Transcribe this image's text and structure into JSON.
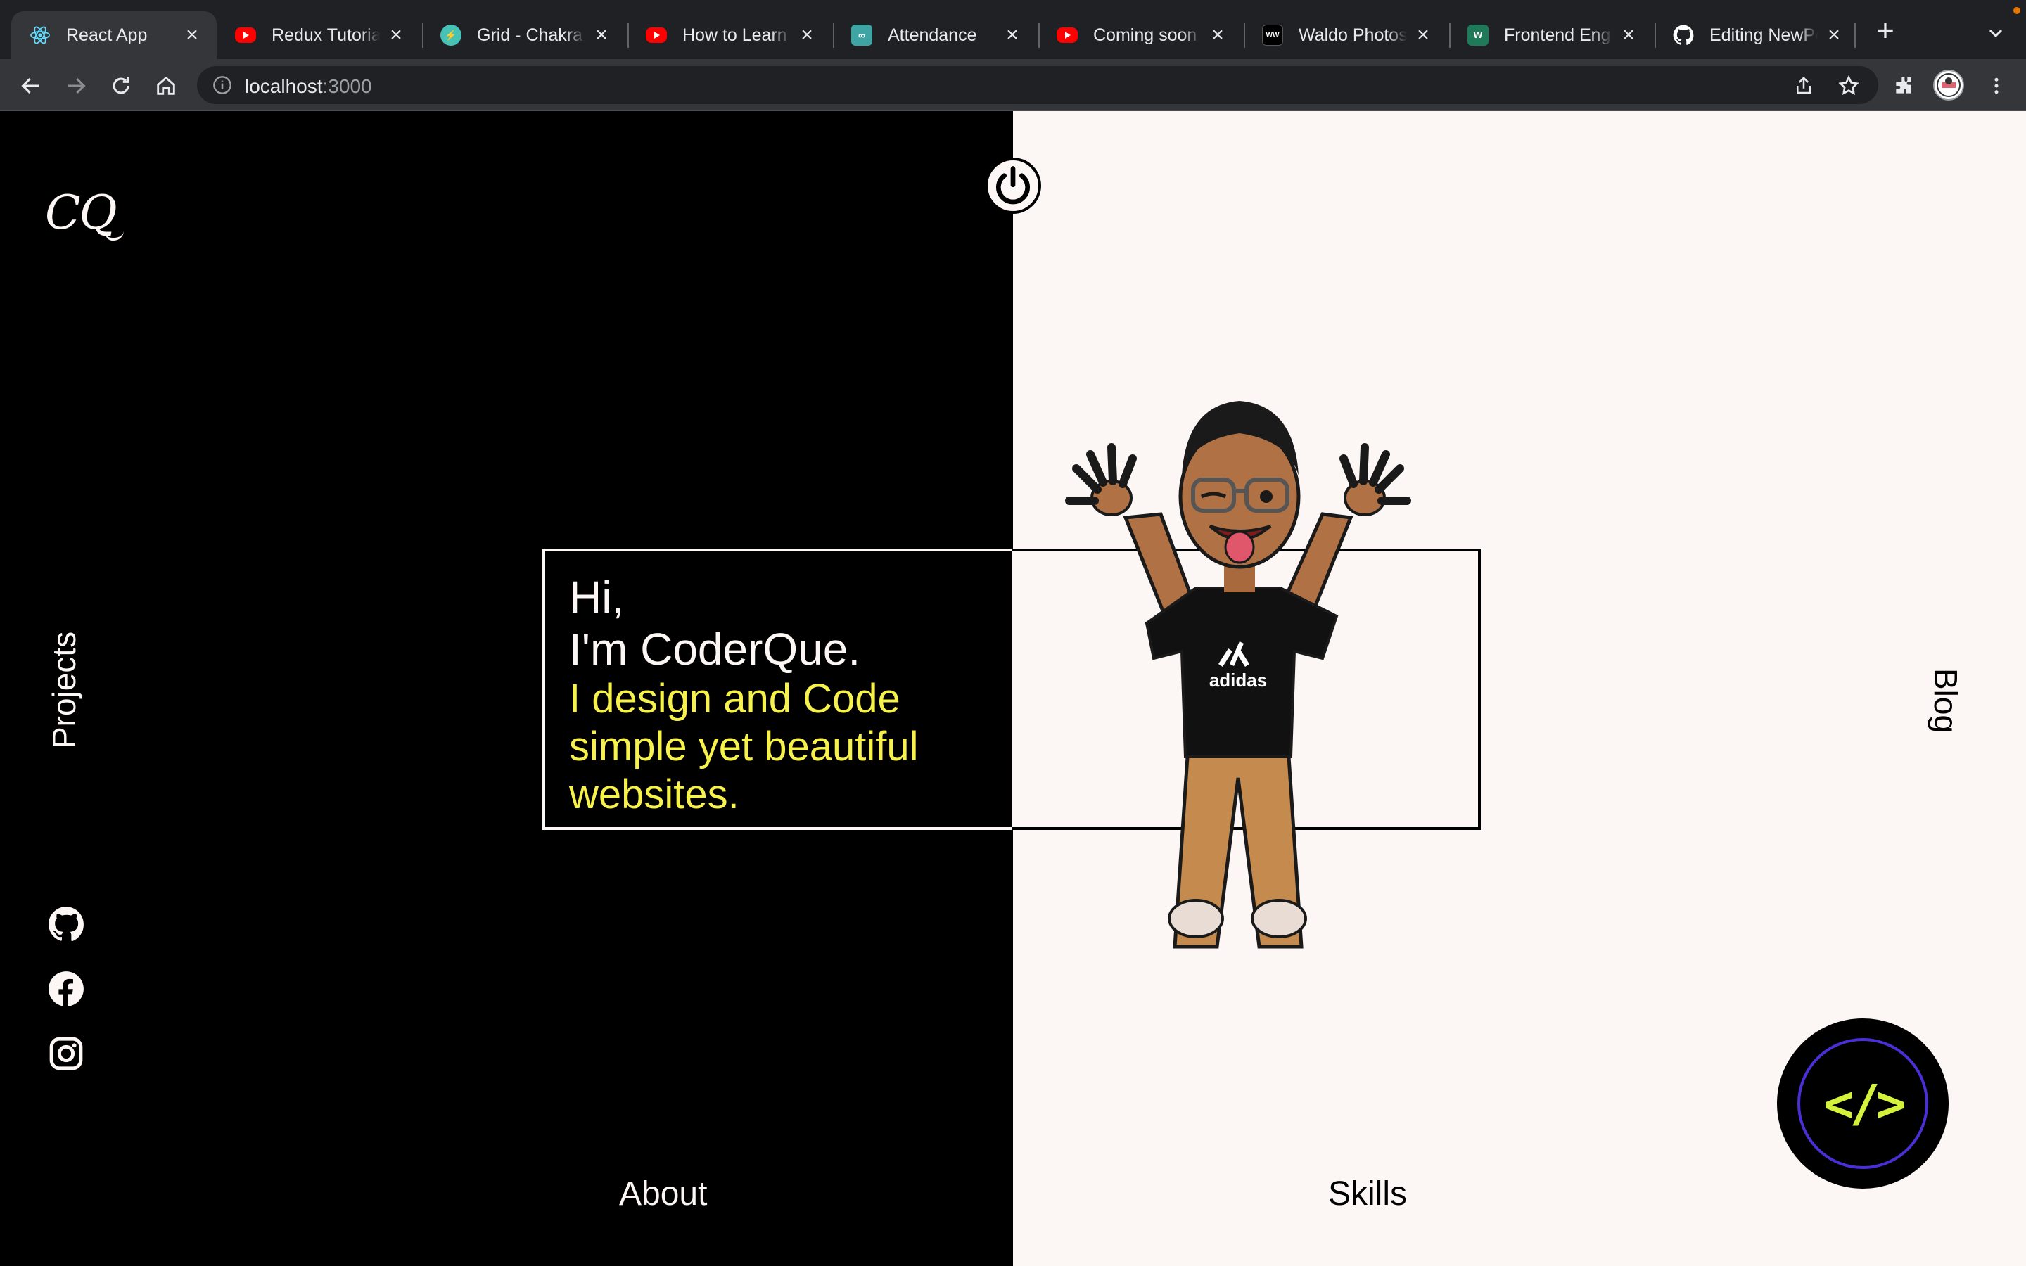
{
  "browser": {
    "tabs": [
      {
        "title": "React App",
        "favicon": "react-icon",
        "color": "#61dafb",
        "active": true
      },
      {
        "title": "Redux Tutorial",
        "favicon": "youtube-icon",
        "color": "#ff0000",
        "active": false
      },
      {
        "title": "Grid - Chakra",
        "favicon": "chakra-icon",
        "color": "#46c3b6",
        "active": false
      },
      {
        "title": "How to Learn",
        "favicon": "youtube-icon",
        "color": "#ff0000",
        "active": false
      },
      {
        "title": "Attendance",
        "favicon": "link-icon",
        "color": "#3ea4a4",
        "active": false
      },
      {
        "title": "Coming soon",
        "favicon": "youtube-icon",
        "color": "#ff0000",
        "active": false
      },
      {
        "title": "Waldo Photos",
        "favicon": "waldo-icon",
        "color": "#000000",
        "active": false
      },
      {
        "title": "Frontend Engi",
        "favicon": "upwork-icon",
        "color": "#1f7a5a",
        "active": false
      },
      {
        "title": "Editing NewPo",
        "favicon": "github-icon",
        "color": "#ffffff",
        "active": false
      }
    ],
    "url_host": "localhost",
    "url_port": ":3000"
  },
  "site": {
    "logo": "CQ",
    "nav": {
      "projects": "Projects",
      "blog": "Blog",
      "about": "About",
      "skills": "Skills"
    },
    "intro": {
      "greeting": "Hi,",
      "name_line": "I'm CoderQue.",
      "tagline": "I design and Code simple yet beautiful websites."
    },
    "code_badge": "</>",
    "social": [
      "github-icon",
      "facebook-icon",
      "instagram-icon"
    ],
    "colors": {
      "dark": "#000000",
      "light": "#fcf6f4",
      "accent": "#f7f24b",
      "badge_ring": "#4a2fd6",
      "badge_text": "#d4f23c"
    }
  }
}
